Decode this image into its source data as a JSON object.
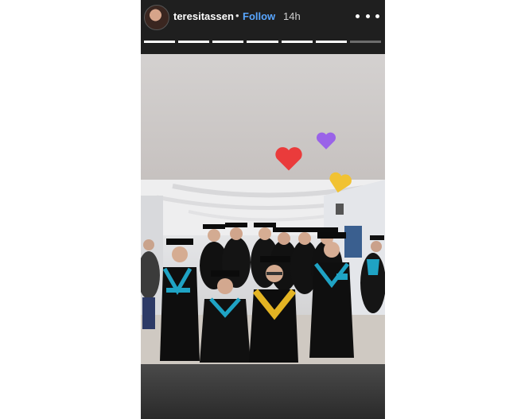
{
  "header": {
    "username": "teresitassen",
    "separator": "•",
    "follow_label": "Follow",
    "time": "14h",
    "more_icon": "more-dots-icon"
  },
  "progress": {
    "segments": 7,
    "completed": 6
  },
  "stickers": [
    {
      "name": "heart-purple",
      "color": "#9a63e8"
    },
    {
      "name": "heart-red",
      "color": "#ea3b3b"
    },
    {
      "name": "heart-yellow",
      "color": "#f1c232"
    }
  ],
  "colors": {
    "gown": "#111111",
    "trim_teal": "#1fa3c4",
    "trim_gold": "#e3b423",
    "accent_link": "#58a6ff"
  }
}
